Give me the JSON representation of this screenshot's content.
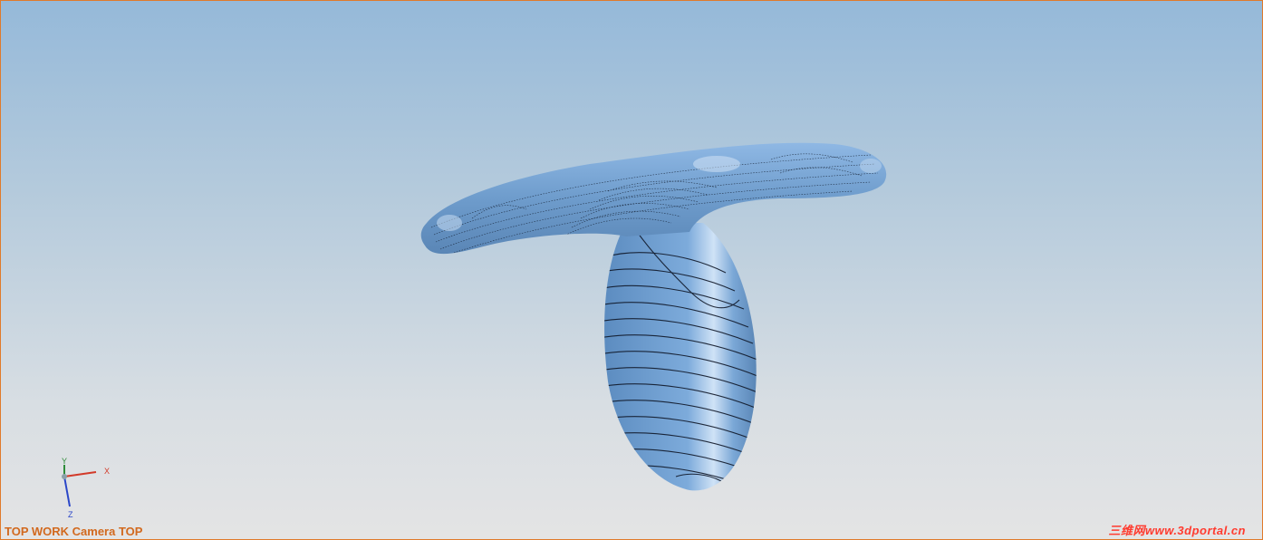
{
  "viewport": {
    "view_label": "TOP WORK Camera TOP",
    "watermark": "三维网www.3dportal.cn",
    "colors": {
      "border": "#e07a2a",
      "model_fill": "#6e9ccc",
      "contour_line": "#000000",
      "status_text": "#d2691e"
    }
  },
  "triad": {
    "x_label": "X",
    "y_label": "Y",
    "z_label": "Z"
  }
}
